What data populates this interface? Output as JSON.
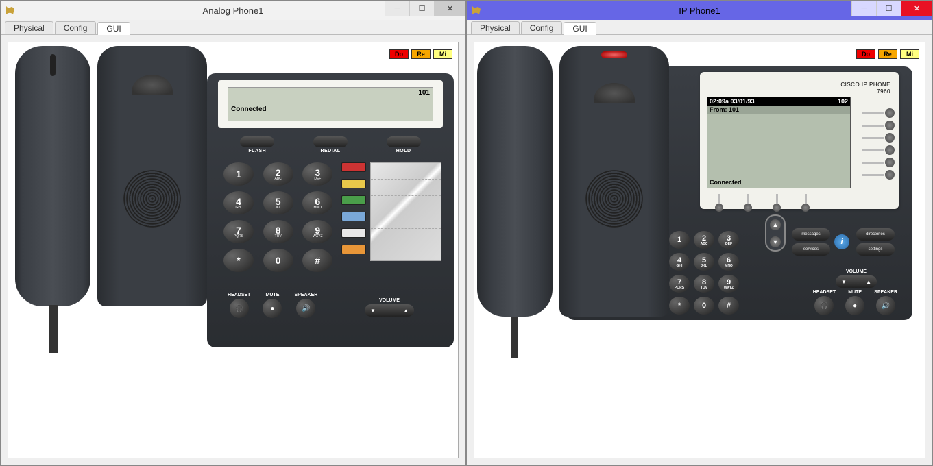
{
  "windows": {
    "analog": {
      "title": "Analog Phone1",
      "tabs": [
        "Physical",
        "Config",
        "GUI"
      ],
      "active_tab": "GUI",
      "tone_buttons": [
        "Do",
        "Re",
        "Mi"
      ],
      "lcd": {
        "number": "101",
        "status": "Connected"
      },
      "func_buttons": [
        "FLASH",
        "REDIAL",
        "HOLD"
      ],
      "keypad": [
        {
          "n": "1",
          "s": ""
        },
        {
          "n": "2",
          "s": "ABC"
        },
        {
          "n": "3",
          "s": "DEF"
        },
        {
          "n": "4",
          "s": "GHI"
        },
        {
          "n": "5",
          "s": "JKL"
        },
        {
          "n": "6",
          "s": "MNO"
        },
        {
          "n": "7",
          "s": "PQRS"
        },
        {
          "n": "8",
          "s": "TUV"
        },
        {
          "n": "9",
          "s": "WXYZ"
        },
        {
          "n": "*",
          "s": ""
        },
        {
          "n": "0",
          "s": ""
        },
        {
          "n": "#",
          "s": ""
        }
      ],
      "bottom_funcs": [
        "HEADSET",
        "MUTE",
        "SPEAKER"
      ],
      "volume_label": "VOLUME"
    },
    "ip": {
      "title": "IP Phone1",
      "tabs": [
        "Physical",
        "Config",
        "GUI"
      ],
      "active_tab": "GUI",
      "tone_buttons": [
        "Do",
        "Re",
        "Mi"
      ],
      "brand": {
        "line1": "CISCO IP PHONE",
        "line2": "7960"
      },
      "display": {
        "time": "02:09a 03/01/93",
        "extension": "102",
        "from": "From: 101",
        "status": "Connected"
      },
      "keypad": [
        {
          "n": "1",
          "s": ""
        },
        {
          "n": "2",
          "s": "ABC"
        },
        {
          "n": "3",
          "s": "DEF"
        },
        {
          "n": "4",
          "s": "GHI"
        },
        {
          "n": "5",
          "s": "JKL"
        },
        {
          "n": "6",
          "s": "MNO"
        },
        {
          "n": "7",
          "s": "PQRS"
        },
        {
          "n": "8",
          "s": "TUV"
        },
        {
          "n": "9",
          "s": "WXYZ"
        },
        {
          "n": "*",
          "s": ""
        },
        {
          "n": "0",
          "s": ""
        },
        {
          "n": "#",
          "s": ""
        }
      ],
      "feature_buttons": [
        "messages",
        "directories",
        "services",
        "settings"
      ],
      "info_button": "i",
      "volume_label": "VOLUME",
      "bottom_funcs": [
        "HEADSET",
        "MUTE",
        "SPEAKER"
      ]
    }
  }
}
